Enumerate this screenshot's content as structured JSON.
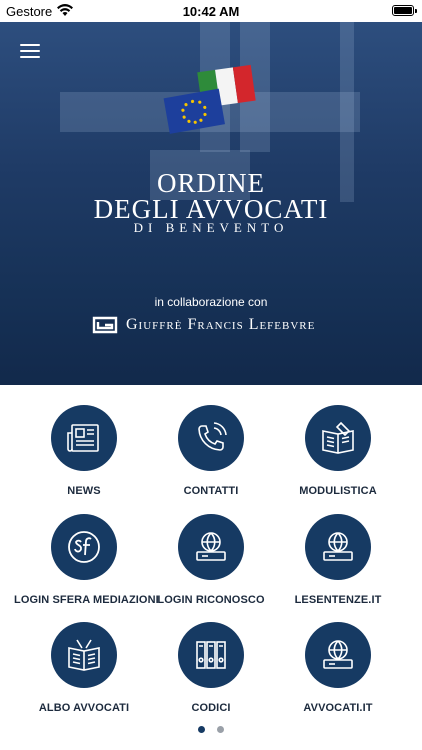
{
  "status_bar": {
    "carrier": "Gestore",
    "time": "10:42 AM"
  },
  "hero": {
    "title_line1": "ORDINE",
    "title_line2": "DEGLI AVVOCATI",
    "title_line3": "DI BENEVENTO",
    "collab_text": "in collaborazione con",
    "partner_name": "Giuffrè Francis Lefebvre"
  },
  "menu": [
    {
      "label": "NEWS",
      "icon": "newspaper-icon"
    },
    {
      "label": "CONTATTI",
      "icon": "phone-icon"
    },
    {
      "label": "MODULISTICA",
      "icon": "form-book-icon"
    },
    {
      "label": "LOGIN SFERA MEDIAZIONI",
      "icon": "sf-logo-icon"
    },
    {
      "label": "LOGIN RICONOSCO",
      "icon": "globe-monitor-icon"
    },
    {
      "label": "LESENTENZE.IT",
      "icon": "globe-monitor-icon"
    },
    {
      "label": "ALBO AVVOCATI",
      "icon": "open-book-icon"
    },
    {
      "label": "CODICI",
      "icon": "binders-icon"
    },
    {
      "label": "AVVOCATI.IT",
      "icon": "globe-monitor-icon"
    }
  ],
  "pager": {
    "pages": 2,
    "active": 0
  },
  "colors": {
    "icon_circle": "#163a63",
    "dot_active": "#163a63",
    "dot_inactive": "#9aa0a8"
  }
}
